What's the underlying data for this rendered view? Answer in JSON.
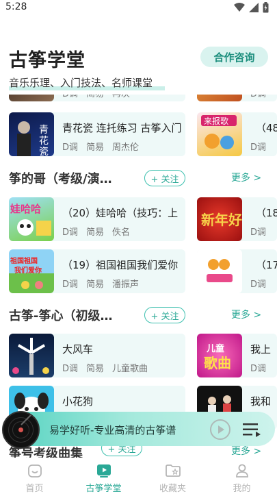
{
  "status": {
    "time": "5:28"
  },
  "header": {
    "title": "古筝学堂",
    "subtitle": "音乐乐理、入门技法、名师课堂",
    "coop_button": "合作咨询"
  },
  "partial_row": {
    "left_meta": [
      "D调",
      "简易",
      "再次"
    ],
    "right_meta": [
      "D调"
    ]
  },
  "row1": {
    "left": {
      "title": "青花瓷 连托练习 古筝入门",
      "meta": [
        "D调",
        "简易",
        "周杰伦"
      ]
    },
    "right": {
      "title": "（48",
      "meta": [
        "D调"
      ]
    }
  },
  "section1": {
    "title": "筝的哥（考级/演…",
    "follow": "+ 关注",
    "more": "更多 >",
    "rows": [
      {
        "left": {
          "title": "（20）娃哈哈（技巧：上",
          "meta": [
            "D调",
            "简易",
            "佚名"
          ]
        },
        "right": {
          "title": "（18",
          "meta": [
            "D调"
          ]
        }
      },
      {
        "left": {
          "title": "（19）祖国祖国我们爱你",
          "meta": [
            "D调",
            "简易",
            "潘振声"
          ]
        },
        "right": {
          "title": "（17",
          "meta": [
            "D调"
          ]
        }
      }
    ]
  },
  "section2": {
    "title": "古筝-筝心（初级…",
    "follow": "+ 关注",
    "more": "更多 >",
    "rows": [
      {
        "left": {
          "title": "大风车",
          "meta": [
            "D调",
            "简易",
            "儿童歌曲"
          ]
        },
        "right": {
          "title": "我上",
          "meta": [
            "D调"
          ]
        }
      },
      {
        "left": {
          "title": "小花狗",
          "meta": []
        },
        "right": {
          "title": "我和",
          "meta": []
        }
      }
    ]
  },
  "section3": {
    "title": "筝号考级曲集",
    "follow": "+ 关注",
    "more": "更多 >"
  },
  "player": {
    "title": "易学好听-专业高清的古筝谱"
  },
  "nav": {
    "items": [
      {
        "label": "首页"
      },
      {
        "label": "古筝学堂"
      },
      {
        "label": "收藏夹"
      },
      {
        "label": "我的"
      }
    ]
  },
  "colors": {
    "accent": "#2aa896",
    "card_bg": "#eef9f8",
    "chip_bg": "#d9f3ef"
  }
}
